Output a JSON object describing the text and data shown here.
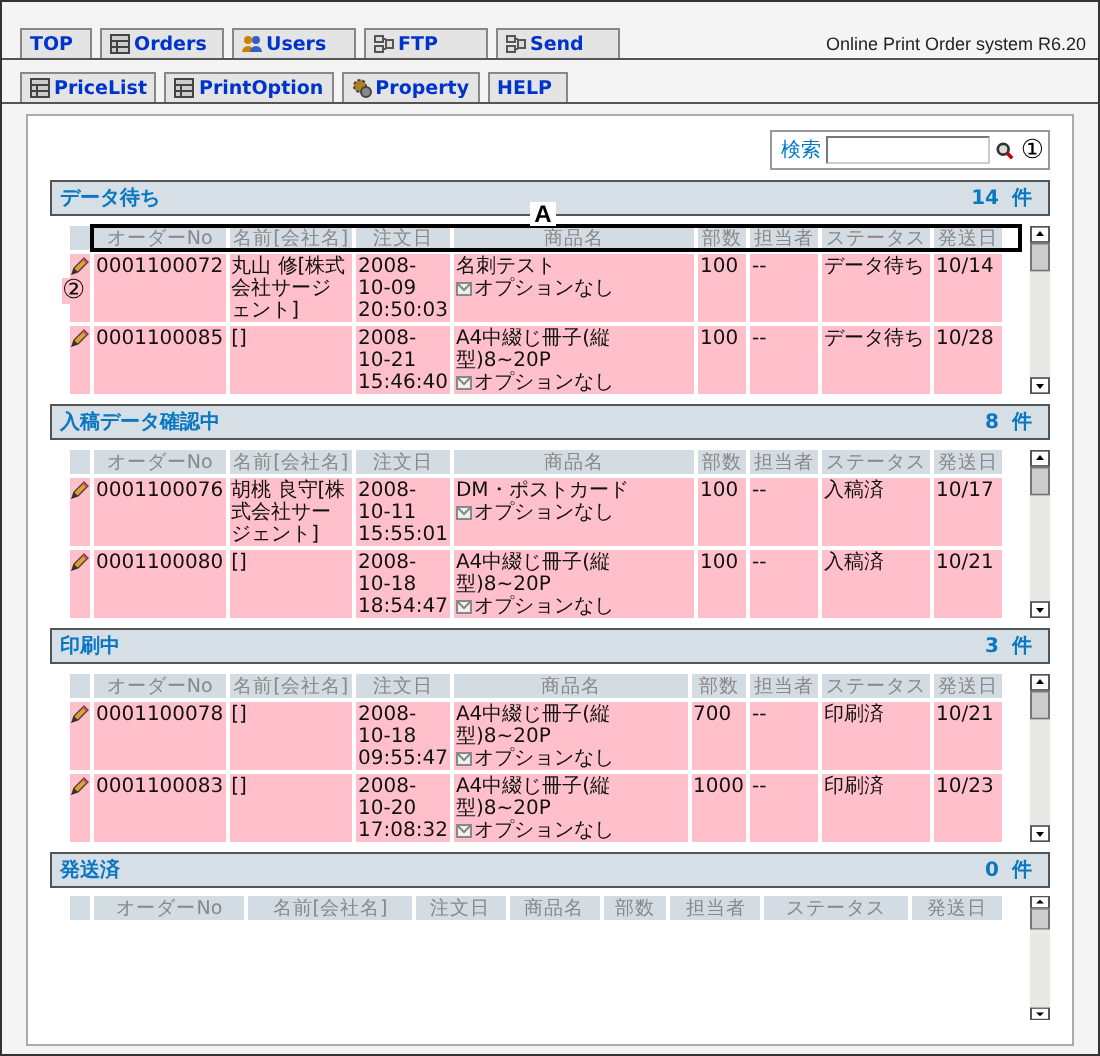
{
  "tabs_primary": [
    {
      "label": "TOP",
      "kind": "plain"
    },
    {
      "label": "Orders",
      "kind": "table"
    },
    {
      "label": "Users",
      "kind": "users"
    },
    {
      "label": "FTP",
      "kind": "network"
    },
    {
      "label": "Send",
      "kind": "network"
    }
  ],
  "system_label": "Online Print Order system R6.20",
  "tabs_secondary": [
    {
      "label": "PriceList",
      "kind": "table"
    },
    {
      "label": "PrintOption",
      "kind": "table"
    },
    {
      "label": "Property",
      "kind": "gear"
    },
    {
      "label": "HELP",
      "kind": "plain"
    }
  ],
  "search": {
    "label": "検索",
    "annotation": "①"
  },
  "sections": [
    {
      "title": "データ待ち",
      "count": "14 件",
      "annotation": "A",
      "columns": [
        "オーダーNo",
        "名前[会社名]",
        "注文日",
        "商品名",
        "部数",
        "担当者",
        "ステータス",
        "発送日"
      ],
      "rows": [
        {
          "order_no": "0001100072",
          "name": "丸山 修[株式会社サージェント]",
          "date": "2008-10-09 20:50:03",
          "product": "名刺テスト",
          "option": "オプションなし",
          "qty": "100",
          "staff": "--",
          "status": "データ待ち",
          "ship_date": "10/14",
          "annotation": "②"
        },
        {
          "order_no": "0001100085",
          "name": "[]",
          "date": "2008-10-21 15:46:40",
          "product": "A4中綴じ冊子(縦型)8~20P",
          "option": "オプションなし",
          "qty": "100",
          "staff": "--",
          "status": "データ待ち",
          "ship_date": "10/28"
        }
      ]
    },
    {
      "title": "入稿データ確認中",
      "count": "8 件",
      "columns": [
        "オーダーNo",
        "名前[会社名]",
        "注文日",
        "商品名",
        "部数",
        "担当者",
        "ステータス",
        "発送日"
      ],
      "rows": [
        {
          "order_no": "0001100076",
          "name": "胡桃 良守[株式会社サージェント]",
          "date": "2008-10-11 15:55:01",
          "product": "DM・ポストカード",
          "option": "オプションなし",
          "qty": "100",
          "staff": "--",
          "status": "入稿済",
          "ship_date": "10/17"
        },
        {
          "order_no": "0001100080",
          "name": "[]",
          "date": "2008-10-18 18:54:47",
          "product": "A4中綴じ冊子(縦型)8~20P",
          "option": "オプションなし",
          "qty": "100",
          "staff": "--",
          "status": "入稿済",
          "ship_date": "10/21"
        }
      ]
    },
    {
      "title": "印刷中",
      "count": "3 件",
      "columns": [
        "オーダーNo",
        "名前[会社名]",
        "注文日",
        "商品名",
        "部数",
        "担当者",
        "ステータス",
        "発送日"
      ],
      "rows": [
        {
          "order_no": "0001100078",
          "name": "[]",
          "date": "2008-10-18 09:55:47",
          "product": "A4中綴じ冊子(縦型)8~20P",
          "option": "オプションなし",
          "qty": "700",
          "staff": "--",
          "status": "印刷済",
          "ship_date": "10/21"
        },
        {
          "order_no": "0001100083",
          "name": "[]",
          "date": "2008-10-20 17:08:32",
          "product": "A4中綴じ冊子(縦型)8~20P",
          "option": "オプションなし",
          "qty": "1000",
          "staff": "--",
          "status": "印刷済",
          "ship_date": "10/23"
        }
      ]
    },
    {
      "title": "発送済",
      "count": "0 件",
      "columns": [
        "オーダーNo",
        "名前[会社名]",
        "注文日",
        "商品名",
        "部数",
        "担当者",
        "ステータス",
        "発送日"
      ]
    }
  ]
}
